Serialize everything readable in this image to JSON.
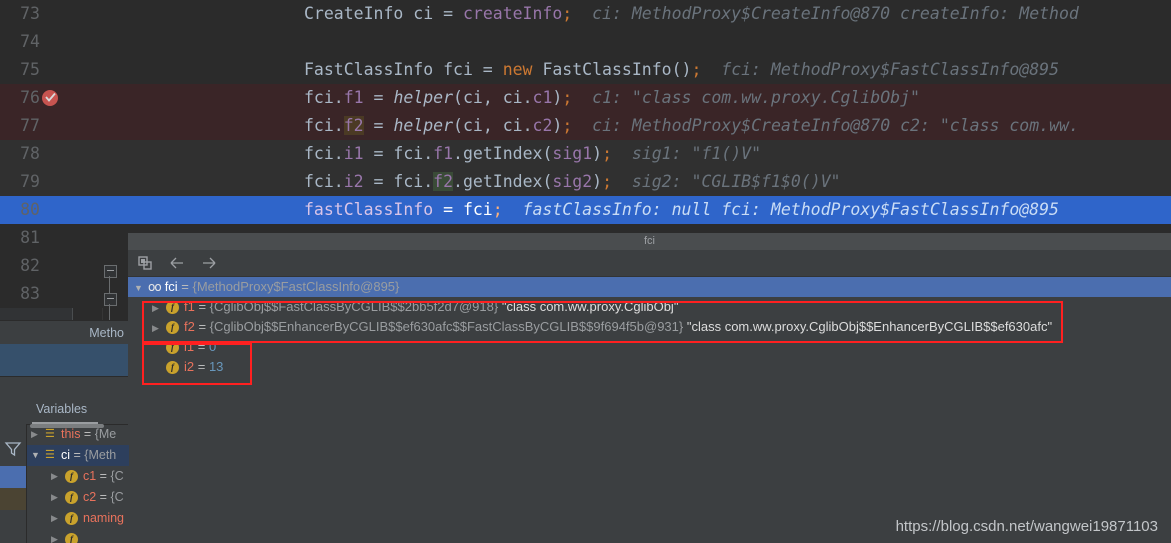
{
  "editor": {
    "lines": [
      {
        "num": "73",
        "breakpoint": false,
        "highlight": "plain",
        "code_html": "<span class=\"t-default\">CreateInfo ci = </span><span class=\"t-field\">createInfo</span><span class=\"t-semi\">;</span>",
        "code_plain": "CreateInfo ci = createInfo;",
        "hint": "ci: MethodProxy$CreateInfo@870   createInfo: Method"
      },
      {
        "num": "74",
        "breakpoint": false,
        "highlight": "plain",
        "code_html": "",
        "code_plain": "",
        "hint": ""
      },
      {
        "num": "75",
        "breakpoint": false,
        "highlight": "plain",
        "code_html": "<span class=\"t-default\">FastClassInfo fci = </span><span class=\"t-kw\">new </span><span class=\"t-default\">FastClassInfo()</span><span class=\"t-semi\">;</span>",
        "code_plain": "FastClassInfo fci = new FastClassInfo();",
        "hint": "fci: MethodProxy$FastClassInfo@895"
      },
      {
        "num": "76",
        "breakpoint": true,
        "highlight": "hl-red",
        "code_html": "<span class=\"t-default\">fci.</span><span class=\"t-field\">f1</span><span class=\"t-default\"> = </span><span class=\"t-method\">helper</span><span class=\"t-default\">(ci, ci.</span><span class=\"t-field\">c1</span><span class=\"t-default\">)</span><span class=\"t-semi\">;</span>",
        "code_plain": "fci.f1 = helper(ci, ci.c1);",
        "hint": "c1: \"class com.ww.proxy.CglibObj\""
      },
      {
        "num": "77",
        "breakpoint": false,
        "highlight": "hl-red",
        "code_html": "<span class=\"t-default\">fci.</span><span class=\"t-field mark-brown\">f2</span><span class=\"t-default\"> = </span><span class=\"t-method\">helper</span><span class=\"t-default\">(ci, ci.</span><span class=\"t-field\">c2</span><span class=\"t-default\">)</span><span class=\"t-semi\">;</span>",
        "code_plain": "fci.f2 = helper(ci, ci.c2);",
        "hint": "ci: MethodProxy$CreateInfo@870   c2: \"class com.ww."
      },
      {
        "num": "78",
        "breakpoint": false,
        "highlight": "alt",
        "code_html": "<span class=\"t-default\">fci.</span><span class=\"t-field\">i1</span><span class=\"t-default\"> = fci.</span><span class=\"t-field\">f1</span><span class=\"t-default\">.getIndex(</span><span class=\"t-field\">sig1</span><span class=\"t-default\">)</span><span class=\"t-semi\">;</span>",
        "code_plain": "fci.i1 = fci.f1.getIndex(sig1);",
        "hint": "sig1: \"f1()V\""
      },
      {
        "num": "79",
        "breakpoint": false,
        "highlight": "alt",
        "code_html": "<span class=\"t-default\">fci.</span><span class=\"t-field\">i2</span><span class=\"t-default\"> = fci.</span><span class=\"t-field mark-green\">f2</span><span class=\"t-default\">.getIndex(</span><span class=\"t-field\">sig2</span><span class=\"t-default\">)</span><span class=\"t-semi\">;</span>",
        "code_plain": "fci.i2 = fci.f2.getIndex(sig2);",
        "hint": "sig2: \"CGLIB$f1$0()V\""
      },
      {
        "num": "80",
        "breakpoint": false,
        "highlight": "hl-blue",
        "code_html": "<span class=\"t-field\">fastClassInfo</span><span class=\"t-default\"> = fci</span><span class=\"t-semi\">;</span>",
        "code_plain": "fastClassInfo = fci;",
        "hint": "fastClassInfo: null   fci: MethodProxy$FastClassInfo@895"
      },
      {
        "num": "81",
        "breakpoint": false,
        "highlight": "plain",
        "code_html": "",
        "code_plain": "",
        "hint": ""
      },
      {
        "num": "82",
        "breakpoint": false,
        "highlight": "plain",
        "code_html": "",
        "code_plain": "",
        "hint": ""
      },
      {
        "num": "83",
        "breakpoint": false,
        "highlight": "plain",
        "code_html": "",
        "code_plain": "",
        "hint": ""
      }
    ],
    "breadcrumb": "Metho"
  },
  "popup": {
    "title": "fci",
    "toolbar": {
      "copy_icon": "copy-value-icon",
      "back_icon": "back-arrow-icon",
      "forward_icon": "forward-arrow-icon"
    },
    "rows": [
      {
        "indent": 0,
        "expanded": true,
        "selected": true,
        "icon": "oo",
        "name": "fci",
        "eq": " = ",
        "ref": "{MethodProxy$FastClassInfo@895}",
        "str": ""
      },
      {
        "indent": 1,
        "expanded": false,
        "selected": false,
        "icon": "f",
        "name": "f1",
        "eq": " = ",
        "ref": "{CglibObj$$FastClassByCGLIB$$2bb5f2d7@918}",
        "str": "\"class com.ww.proxy.CglibObj\""
      },
      {
        "indent": 1,
        "expanded": false,
        "selected": false,
        "icon": "f",
        "name": "f2",
        "eq": " = ",
        "ref": "{CglibObj$$EnhancerByCGLIB$$ef630afc$$FastClassByCGLIB$$9f694f5b@931}",
        "str": "\"class com.ww.proxy.CglibObj$$EnhancerByCGLIB$$ef630afc\""
      },
      {
        "indent": 1,
        "expanded": null,
        "selected": false,
        "icon": "f",
        "name": "i1",
        "eq": " = ",
        "ref": "",
        "num": "0"
      },
      {
        "indent": 1,
        "expanded": null,
        "selected": false,
        "icon": "f",
        "name": "i2",
        "eq": " = ",
        "ref": "",
        "num": "13"
      }
    ]
  },
  "variables": {
    "tab_label": "Variables",
    "filter_icon": "filter-icon",
    "rows": [
      {
        "expanded": false,
        "selected": false,
        "icon": "list",
        "name": "this",
        "eq": " = ",
        "ref": "{Me"
      },
      {
        "expanded": true,
        "selected": true,
        "icon": "list",
        "name": "ci",
        "eq": " = ",
        "ref": "{Meth"
      },
      {
        "expanded": false,
        "selected": false,
        "icon": "f",
        "name": "c1",
        "eq": " = ",
        "ref": "{C",
        "indent": 1
      },
      {
        "expanded": false,
        "selected": false,
        "icon": "f",
        "name": "c2",
        "eq": " = ",
        "ref": "{C",
        "indent": 1
      },
      {
        "expanded": false,
        "selected": false,
        "icon": "f",
        "name": "naming",
        "eq": "",
        "ref": "",
        "indent": 1
      },
      {
        "expanded": false,
        "selected": false,
        "icon": "f",
        "name": "",
        "eq": "",
        "ref": "",
        "indent": 1
      }
    ]
  },
  "watermark": "https://blog.csdn.net/wangwei19871103",
  "colors": {
    "editor_bg": "#2b2b2b",
    "gutter_bg": "#313335",
    "panel_bg": "#3c3f41",
    "selection_blue": "#2f65ca",
    "tree_selection": "#4b6eaf",
    "breakpoint_red": "#c75450",
    "highlight_red_line": "#3a2527",
    "annotation_red": "#ff2020",
    "keyword_orange": "#cc7832",
    "field_purple": "#9876aa",
    "hint_gray": "#6a737c",
    "number_blue": "#6897bb",
    "var_name_red": "#e8725c",
    "icon_gold": "#c9a22c"
  }
}
